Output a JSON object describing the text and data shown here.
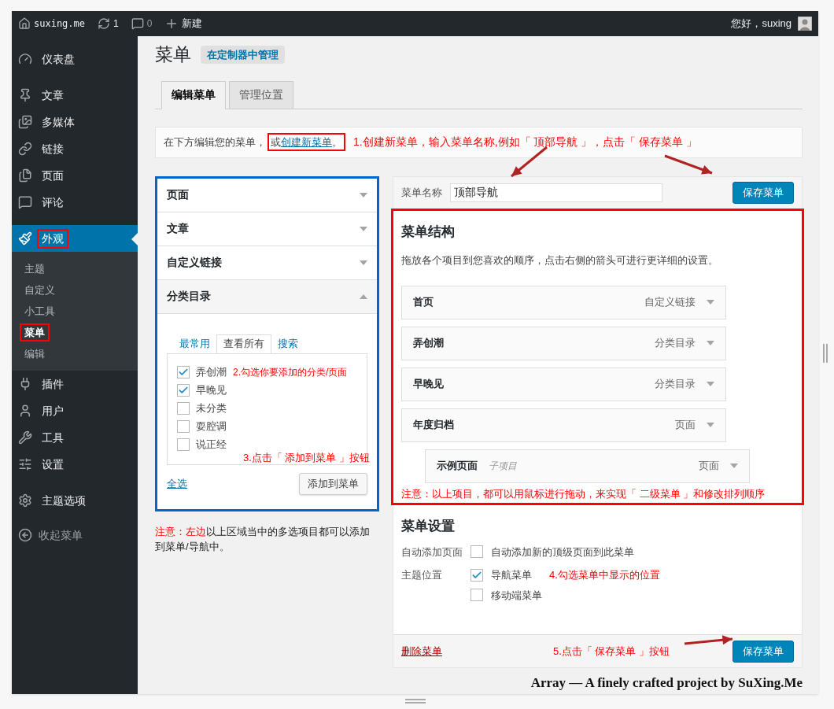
{
  "admin_bar": {
    "site": "suxing.me",
    "updates": "1",
    "comments": "0",
    "new": "新建",
    "greeting": "您好，suxing"
  },
  "sidebar": {
    "groups": [
      {
        "items": [
          {
            "label": "仪表盘",
            "selected": false,
            "highlighted": false
          }
        ]
      },
      {
        "items": [
          {
            "label": "文章",
            "selected": false,
            "highlighted": false
          },
          {
            "label": "多媒体",
            "selected": false,
            "highlighted": false
          },
          {
            "label": "链接",
            "selected": false,
            "highlighted": false
          },
          {
            "label": "页面",
            "selected": false,
            "highlighted": false
          },
          {
            "label": "评论",
            "selected": false,
            "highlighted": false
          }
        ]
      },
      {
        "items": [
          {
            "label": "外观",
            "selected": true,
            "highlighted": true,
            "children": [
              {
                "label": "主题",
                "selected": false,
                "highlighted": false
              },
              {
                "label": "自定义",
                "selected": false,
                "highlighted": false
              },
              {
                "label": "小工具",
                "selected": false,
                "highlighted": false
              },
              {
                "label": "菜单",
                "selected": true,
                "highlighted": true
              },
              {
                "label": "编辑",
                "selected": false,
                "highlighted": false
              }
            ]
          },
          {
            "label": "插件",
            "selected": false,
            "highlighted": false
          },
          {
            "label": "用户",
            "selected": false,
            "highlighted": false
          },
          {
            "label": "工具",
            "selected": false,
            "highlighted": false
          },
          {
            "label": "设置",
            "selected": false,
            "highlighted": false
          }
        ]
      },
      {
        "items": [
          {
            "label": "主题选项",
            "selected": false,
            "highlighted": false
          }
        ]
      }
    ],
    "collapse": "收起菜单"
  },
  "page": {
    "title": "菜单",
    "action": "在定制器中管理",
    "tabs": [
      {
        "label": "编辑菜单",
        "selected": true
      },
      {
        "label": "管理位置",
        "selected": false
      }
    ],
    "notice": {
      "text": "在下方编辑您的菜单，",
      "link_prefix": "或",
      "link": "创建新菜单",
      "link_suffix": "。",
      "highlighted": true,
      "annotation": "1.创建新菜单，输入菜单名称,例如「 顶部导航 」，点击「 保存菜单 」"
    },
    "sections": [
      {
        "title": "页面",
        "expanded": false
      },
      {
        "title": "文章",
        "expanded": false
      },
      {
        "title": "自定义链接",
        "expanded": false
      },
      {
        "title": "分类目录",
        "expanded": true
      }
    ],
    "category_tabs": [
      {
        "label": "最常用",
        "selected": false
      },
      {
        "label": "查看所有",
        "selected": true
      },
      {
        "label": "搜索",
        "selected": false
      }
    ],
    "categories": [
      {
        "label": "弄创潮",
        "checked": true
      },
      {
        "label": "早晚见",
        "checked": true
      },
      {
        "label": "未分类",
        "checked": false
      },
      {
        "label": "耍腔调",
        "checked": false
      },
      {
        "label": "说正经",
        "checked": false
      }
    ],
    "annotation_2": "2.勾选你要添加的分类/页面",
    "annotation_3": "3.点击「 添加到菜单 」按钮",
    "select_all": "全选",
    "add_button": "添加到菜单",
    "left_note": {
      "highlight": "注意：左边",
      "text": "以上区域当中的多选项目都可以添加到菜单/导航中。"
    },
    "menu_name_label": "菜单名称",
    "menu_name_value": "顶部导航",
    "save_button": "保存菜单",
    "structure": {
      "title": "菜单结构",
      "description": "拖放各个项目到您喜欢的顺序，点击右侧的箭头可进行更详细的设置。",
      "items": [
        {
          "title": "首页",
          "type": "自定义链接"
        },
        {
          "title": "弄创潮",
          "type": "分类目录"
        },
        {
          "title": "早晚见",
          "type": "分类目录"
        },
        {
          "title": "年度归档",
          "type": "页面",
          "children": [
            {
              "title": "示例页面",
              "note": "子项目",
              "type": "页面"
            }
          ]
        }
      ],
      "annotation": "注意：以上项目，都可以用鼠标进行拖动，来实现「 二级菜单 」和修改排列顺序"
    },
    "settings": {
      "title": "菜单设置",
      "rows": [
        {
          "label": "自动添加页面",
          "options": [
            {
              "label": "自动添加新的顶级页面到此菜单",
              "checked": false
            }
          ]
        },
        {
          "label": "主题位置",
          "options": [
            {
              "label": "导航菜单",
              "checked": true
            },
            {
              "label": "移动端菜单",
              "checked": false
            }
          ],
          "annotation": "4.勾选菜单中显示的位置"
        }
      ]
    },
    "delete_link": "删除菜单",
    "annotation_5": "5.点击「 保存菜单 」按钮",
    "save_button_bottom": "保存菜单"
  },
  "footer": "Array — A finely crafted project by SuXing.Me"
}
